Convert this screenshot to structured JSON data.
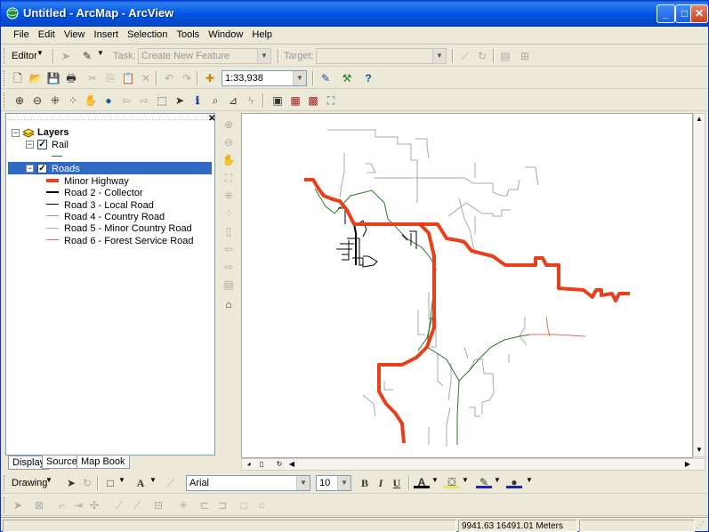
{
  "window": {
    "title": "Untitled - ArcMap - ArcView"
  },
  "menu": [
    "File",
    "Edit",
    "View",
    "Insert",
    "Selection",
    "Tools",
    "Window",
    "Help"
  ],
  "editor_toolbar": {
    "editor_label": "Editor",
    "task_label": "Task:",
    "task_value": "Create New Feature",
    "target_label": "Target:",
    "target_value": ""
  },
  "standard_toolbar": {
    "scale_value": "1:33,938"
  },
  "toc": {
    "root": "Layers",
    "layers": [
      {
        "name": "Rail",
        "checked": true
      },
      {
        "name": "Roads",
        "checked": true,
        "selected": true
      }
    ],
    "roads_legend": [
      {
        "label": "Minor Highway",
        "color": "#e8401c",
        "width": 4
      },
      {
        "label": "Road 2 - Collector",
        "color": "#000000",
        "width": 2
      },
      {
        "label": "Road 3 - Local Road",
        "color": "#000000",
        "width": 1
      },
      {
        "label": "Road 4 - Country Road",
        "color": "#9a9a9a",
        "width": 1
      },
      {
        "label": "Road 5 - Minor Country Road",
        "color": "#b0b0b0",
        "width": 1
      },
      {
        "label": "Road 6 - Forest Service Road",
        "color": "#e07050",
        "width": 1
      }
    ],
    "rail_color": "#2a7a2a"
  },
  "tabs": [
    "Display",
    "Source",
    "Map Book"
  ],
  "drawing_toolbar": {
    "drawing_label": "Drawing",
    "font_value": "Arial",
    "size_value": "10",
    "bold": "B",
    "italic": "I",
    "underline": "U"
  },
  "status": {
    "coordinates": "9941.63  16491.01 Meters"
  },
  "colors": {
    "highway": "#e8401c",
    "rail": "#2a7a2a",
    "selection": "#316ac5",
    "titlebar": "#0054e3"
  }
}
